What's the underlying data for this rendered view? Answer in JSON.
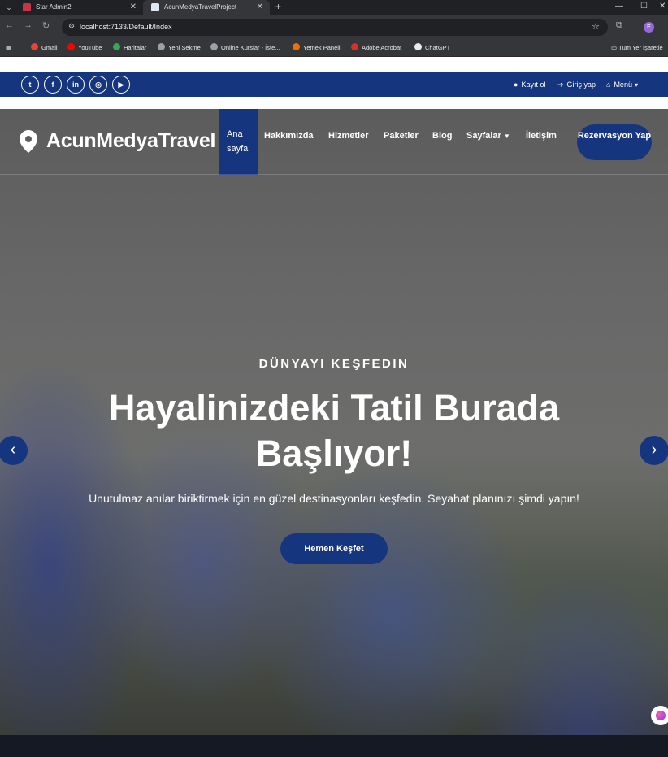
{
  "browser": {
    "tabs": [
      {
        "title": "Star Admin2",
        "active": false
      },
      {
        "title": "AcunMedyaTravelProject",
        "active": true
      }
    ],
    "url": "localhost:7133/Default/Index",
    "profile_initial": "E",
    "bookmarks": [
      {
        "label": "Gmail",
        "color": "#ea4335"
      },
      {
        "label": "YouTube",
        "color": "#ff0000"
      },
      {
        "label": "Haritalar",
        "color": "#34a853"
      },
      {
        "label": "Yeni Sekme",
        "color": "#9aa0a6"
      },
      {
        "label": "Online Kurslar - İste...",
        "color": "#9aa0a6"
      },
      {
        "label": "Yemek Paneli",
        "color": "#e8710a"
      },
      {
        "label": "Adobe Acrobat",
        "color": "#d93025"
      },
      {
        "label": "ChatGPT",
        "color": "#e8eaed"
      }
    ],
    "all_bookmarks": "Tüm Yer İşaretle"
  },
  "topbar": {
    "background": "#16357f",
    "social_icons": [
      "twitter-icon",
      "facebook-icon",
      "linkedin-icon",
      "instagram-icon",
      "youtube-icon"
    ],
    "links": {
      "register": "Kayıt ol",
      "login": "Giriş yap",
      "menu": "Menü"
    }
  },
  "navbar": {
    "brand": "AcunMedyaTravel",
    "items": [
      {
        "label": "Ana sayfa",
        "active": true
      },
      {
        "label": "Hakkımızda"
      },
      {
        "label": "Hizmetler"
      },
      {
        "label": "Paketler"
      },
      {
        "label": "Blog"
      },
      {
        "label": "Sayfalar",
        "dropdown": true
      },
      {
        "label": "İletişim"
      }
    ],
    "cta": "Rezervasyon Yap"
  },
  "hero": {
    "eyebrow": "DÜNYAYI KEŞFEDIN",
    "headline": "Hayalinizdeki Tatil Burada Başlıyor!",
    "subline": "Unutulmaz anılar biriktirmek için en güzel destinasyonları keşfedin. Seyahat planınızı şimdi yapın!",
    "button": "Hemen Keşfet",
    "accent": "#16357f"
  }
}
